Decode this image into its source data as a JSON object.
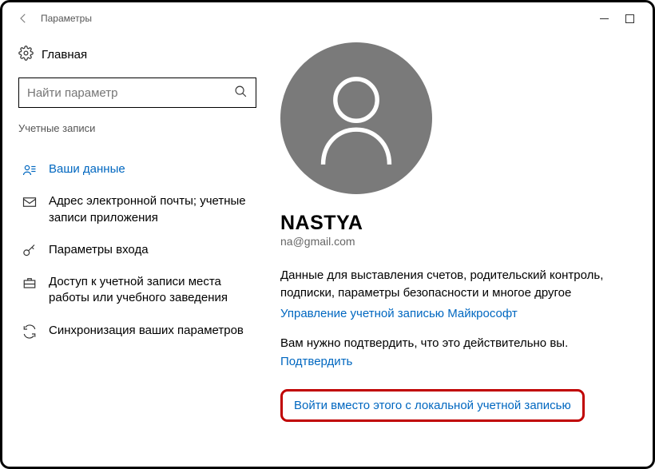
{
  "window": {
    "title": "Параметры"
  },
  "sidebar": {
    "home": "Главная",
    "search_placeholder": "Найти параметр",
    "section": "Учетные записи",
    "items": [
      {
        "label": "Ваши данные"
      },
      {
        "label": "Адрес электронной почты; учетные записи приложения"
      },
      {
        "label": "Параметры входа"
      },
      {
        "label": "Доступ к учетной записи места работы или учебного заведения"
      },
      {
        "label": "Синхронизация ваших параметров"
      }
    ]
  },
  "profile": {
    "name": "NASTYA",
    "email": "na@gmail.com",
    "billing_text": "Данные для выставления счетов, родительский контроль, подписки, параметры безопасности и многое другое",
    "manage_link": "Управление учетной записью Майкрософт",
    "verify_text": "Вам нужно подтвердить, что это действительно вы.",
    "verify_link": "Подтвердить",
    "local_login_link": "Войти вместо этого с локальной учетной записью"
  }
}
